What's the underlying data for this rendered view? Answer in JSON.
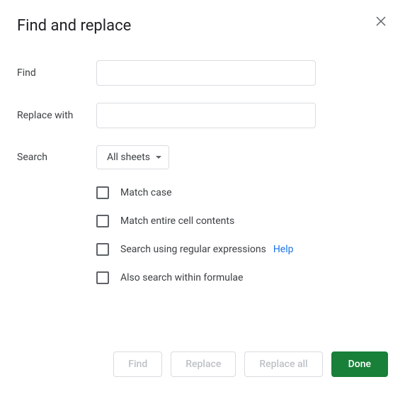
{
  "title": "Find and replace",
  "labels": {
    "find": "Find",
    "replace_with": "Replace with",
    "search": "Search"
  },
  "inputs": {
    "find_value": "",
    "replace_value": ""
  },
  "dropdown": {
    "selected": "All sheets"
  },
  "checkboxes": {
    "match_case": "Match case",
    "match_entire": "Match entire cell contents",
    "regex": "Search using regular expressions",
    "formulae": "Also search within formulae"
  },
  "help_link": "Help",
  "buttons": {
    "find": "Find",
    "replace": "Replace",
    "replace_all": "Replace all",
    "done": "Done"
  }
}
